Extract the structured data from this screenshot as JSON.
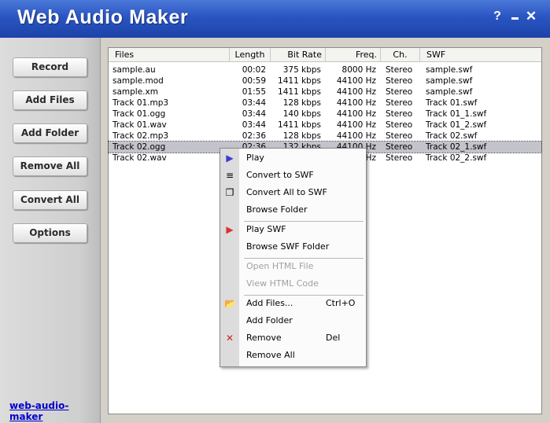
{
  "window": {
    "title": "Web Audio Maker",
    "help": "?",
    "close": "✕"
  },
  "sidebar": {
    "buttons": [
      "Record",
      "Add Files",
      "Add Folder",
      "Remove All",
      "Convert All",
      "Options"
    ],
    "link": "web-audio-maker"
  },
  "list": {
    "columns": [
      "Files",
      "Length",
      "Bit Rate",
      "Freq.",
      "Ch.",
      "SWF"
    ],
    "rows": [
      {
        "file": "sample.au",
        "length": "00:02",
        "bitrate": "375 kbps",
        "freq": "8000 Hz",
        "ch": "Stereo",
        "swf": "sample.swf"
      },
      {
        "file": "sample.mod",
        "length": "00:59",
        "bitrate": "1411 kbps",
        "freq": "44100 Hz",
        "ch": "Stereo",
        "swf": "sample.swf"
      },
      {
        "file": "sample.xm",
        "length": "01:55",
        "bitrate": "1411 kbps",
        "freq": "44100 Hz",
        "ch": "Stereo",
        "swf": "sample.swf"
      },
      {
        "file": "Track 01.mp3",
        "length": "03:44",
        "bitrate": "128 kbps",
        "freq": "44100 Hz",
        "ch": "Stereo",
        "swf": "Track 01.swf"
      },
      {
        "file": "Track 01.ogg",
        "length": "03:44",
        "bitrate": "140 kbps",
        "freq": "44100 Hz",
        "ch": "Stereo",
        "swf": "Track 01_1.swf"
      },
      {
        "file": "Track 01.wav",
        "length": "03:44",
        "bitrate": "1411 kbps",
        "freq": "44100 Hz",
        "ch": "Stereo",
        "swf": "Track 01_2.swf"
      },
      {
        "file": "Track 02.mp3",
        "length": "02:36",
        "bitrate": "128 kbps",
        "freq": "44100 Hz",
        "ch": "Stereo",
        "swf": "Track 02.swf"
      },
      {
        "file": "Track 02.ogg",
        "length": "02:36",
        "bitrate": "132 kbps",
        "freq": "44100 Hz",
        "ch": "Stereo",
        "swf": "Track 02_1.swf"
      },
      {
        "file": "Track 02.wav",
        "length": "",
        "bitrate": "",
        "freq": "Hz",
        "ch": "Stereo",
        "swf": "Track 02_2.swf"
      }
    ],
    "selected_index": 7
  },
  "context_menu": {
    "play": "Play",
    "convert_to_swf": "Convert to SWF",
    "convert_all_to_swf": "Convert All to SWF",
    "browse_folder": "Browse Folder",
    "play_swf": "Play SWF",
    "browse_swf_folder": "Browse SWF Folder",
    "open_html_file": "Open HTML File",
    "view_html_code": "View HTML Code",
    "add_files": "Add Files...",
    "add_files_shortcut": "Ctrl+O",
    "add_folder": "Add Folder",
    "remove": "Remove",
    "remove_shortcut": "Del",
    "remove_all": "Remove All"
  },
  "colors": {
    "titlebar": "#2a55c2",
    "selection": "#c3c3cb",
    "link": "#0000cc",
    "play_icon": "#3a3ad0",
    "play_swf_icon": "#e03030",
    "remove_icon": "#d02020"
  }
}
